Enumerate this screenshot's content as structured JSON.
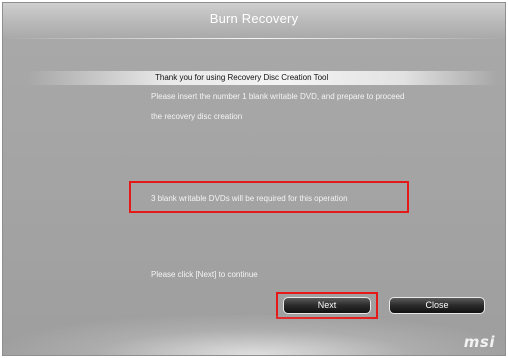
{
  "window": {
    "title": "Burn Recovery"
  },
  "header": {
    "text": "Thank you for using Recovery Disc Creation Tool"
  },
  "description": {
    "line1": "Please insert the  number 1  blank writable DVD, and prepare to proceed",
    "line2": "the recovery disc creation"
  },
  "notice": {
    "text": "3 blank writable DVDs will be required for this operation"
  },
  "hint": {
    "text": "Please click [Next] to continue"
  },
  "buttons": {
    "next_label": "Next",
    "close_label": "Close"
  },
  "branding": {
    "logo_text": "msi"
  },
  "colors": {
    "highlight": "#e61919",
    "background": "#a6a6a6"
  }
}
